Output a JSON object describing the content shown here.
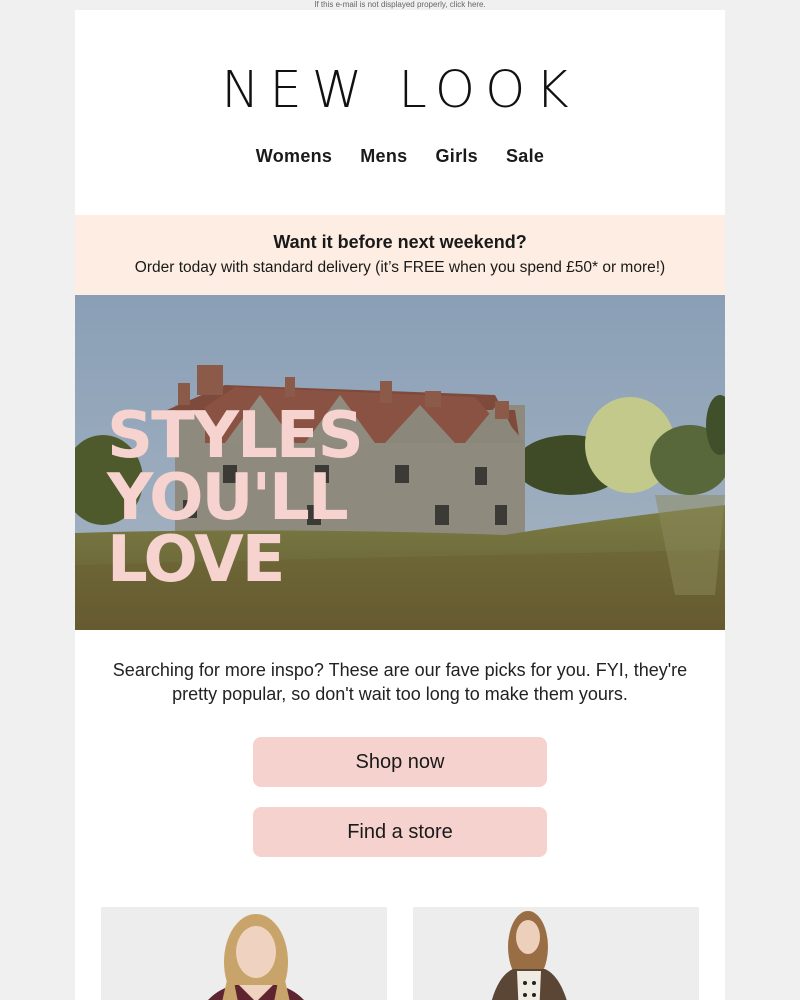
{
  "preheader": {
    "text": "If this e-mail is not displayed properly, click here."
  },
  "brand": {
    "logo_text": "NEW LOOK"
  },
  "nav": {
    "items": [
      "Womens",
      "Mens",
      "Girls",
      "Sale"
    ]
  },
  "promo": {
    "headline": "Want it before next weekend?",
    "subline": "Order today with standard delivery (it’s FREE when you spend £50* or more!)"
  },
  "hero": {
    "lines": [
      "STYLES",
      "YOU'LL",
      "LOVE"
    ]
  },
  "intro": {
    "text": "Searching for more inspo? These are our fave picks for you. FYI, they're pretty popular, so don't wait too long to make them yours."
  },
  "buttons": {
    "shop_label": "Shop now",
    "store_label": "Find a store"
  },
  "colors": {
    "page_bg": "#f0f0f0",
    "promo_bg": "#fdede2",
    "button_bg": "#f5d2cd",
    "hero_text": "#f7d3cf"
  }
}
